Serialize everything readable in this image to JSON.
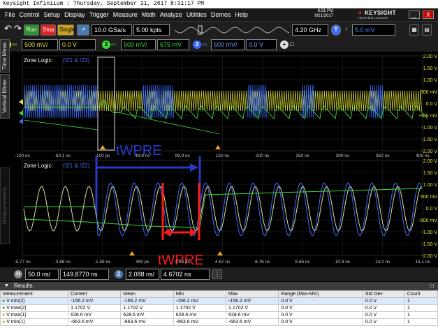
{
  "window": {
    "title": "Keysight Infiniium : Thursday, September 21, 2017 8:31:17 PM"
  },
  "menu": [
    "File",
    "Control",
    "Setup",
    "Display",
    "Trigger",
    "Measure",
    "Math",
    "Analyze",
    "Utilities",
    "Demos",
    "Help"
  ],
  "clock": {
    "time": "8:31 PM",
    "date": "9/21/2017"
  },
  "brand": {
    "name": "KEYSIGHT",
    "sub": "TECHNOLOGIES"
  },
  "window_buttons": {
    "minimize": "_",
    "close": "X"
  },
  "toolbar": {
    "run": "Run",
    "stop": "Stop",
    "single": "Single",
    "sample_rate": "10.0 GSa/s",
    "memory_depth": "5.00 kpts",
    "bandwidth": "4.20 GHz",
    "trigger_level": "5.0 mV"
  },
  "channels": [
    {
      "num": "1",
      "tag": "50Ω",
      "scale": "500 mV/",
      "offset": "0.0 V",
      "color": "#e8e840"
    },
    {
      "num": "2",
      "tag": "50Ω",
      "scale": "500 mV/",
      "offset": "675 mV",
      "color": "#3ad83a"
    },
    {
      "num": "3",
      "tag": "50Ω",
      "scale": "500 mV/",
      "offset": "0.0 V",
      "color": "#3a6bff"
    }
  ],
  "side_tabs": {
    "time": "Time Meas",
    "vertical": "Vertical Meas",
    "measurements": "Measurements"
  },
  "plot_top": {
    "zone_title": "Zone Logic:",
    "zone_expr": "(!Z1 & !Z2)",
    "annotation": "tWPRE",
    "x_ticks": [
      "-100 ns",
      "-50.1 ns",
      "-100 ps",
      "49.9 ns",
      "99.9 ns",
      "150 ns",
      "200 ns",
      "250 ns",
      "300 ns",
      "350 ns",
      "400 ns"
    ],
    "y_ticks": [
      "2.00 V",
      "1.50 V",
      "1.00 V",
      "500 mV",
      "0.0 V",
      "-500 mV",
      "-1.00 V",
      "-1.50 V",
      "-2.00 V"
    ]
  },
  "plot_bottom": {
    "zone_title": "Zone Logic:",
    "zone_expr": "(!Z1 & !Z2)",
    "annotation": "tWPRE",
    "x_ticks": [
      "-5.77 ns",
      "-3.68 ns",
      "-1.59 ns",
      "490 ps",
      "2.58 ns",
      "4.67 ns",
      "6.76 ns",
      "8.85 ns",
      "10.9 ns",
      "13.0 ns",
      "15.1 ns"
    ],
    "y_ticks": [
      "2.00 V",
      "1.50 V",
      "1.00 V",
      "500 mV",
      "0.0 V",
      "-500 mV",
      "-1.00 V",
      "-1.50 V",
      "-2.00 V"
    ]
  },
  "horizontal": {
    "label": "H",
    "scale": "50.0 ns/",
    "position": "149.8770 ns",
    "zoom_num": "2",
    "zoom_scale": "2.088 ns/",
    "zoom_position": "4.6702 ns"
  },
  "results": {
    "title": "Results",
    "columns": [
      "Measurement",
      "Current",
      "Mean",
      "Min",
      "Max",
      "Range (Max-Min)",
      "Std Dev",
      "Count"
    ],
    "rows": [
      [
        "V min(2)",
        "-156.2 mV",
        "-156.2 mV",
        "-156.2 mV",
        "-156.2 mV",
        "0.0 V",
        "0.0 V",
        "1"
      ],
      [
        "V max(2)",
        "1.1702 V",
        "1.1702 V",
        "1.1702 V",
        "1.1702 V",
        "0.0 V",
        "0.0 V",
        "1"
      ],
      [
        "V max(1)",
        "628.6 mV",
        "628.6 mV",
        "628.6 mV",
        "628.6 mV",
        "0.0 V",
        "0.0 V",
        "1"
      ],
      [
        "V min(1)",
        "-663.6 mV",
        "-663.6 mV",
        "-663.6 mV",
        "-663.6 mV",
        "0.0 V",
        "0.0 V",
        "1"
      ]
    ]
  }
}
